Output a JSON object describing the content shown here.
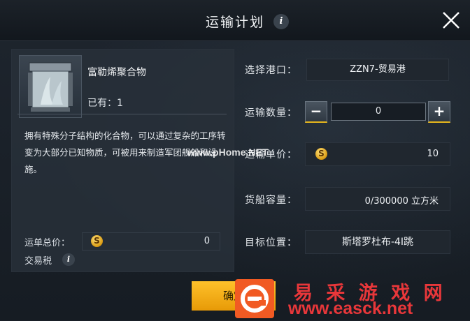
{
  "header": {
    "title": "运输计划"
  },
  "item": {
    "name": "富勒烯聚合物",
    "owned": "已有：1",
    "description": "拥有特殊分子结构的化合物，可以通过复杂的工序转变为大部分已知物质，可被用来制造军团舰船和设施。"
  },
  "summary": {
    "total_label": "运单总价：",
    "total_value": "0",
    "tax_label": "交易税"
  },
  "form": {
    "port_label": "选择港口：",
    "port_value": "ZZN7-贸易港",
    "qty_label": "运输数量：",
    "qty_value": "0",
    "price_label": "运输单价：",
    "price_value": "10",
    "capacity_label": "货船容量：",
    "capacity_value": "0/300000 立方米",
    "dest_label": "目标位置：",
    "dest_value": "斯塔罗杜布-4I跳"
  },
  "confirm_label": "确定",
  "watermarks": {
    "pc": "www.pHome.NET",
    "site_cn": "易 采 游 戏 网",
    "site_url": "www.easck.net"
  }
}
